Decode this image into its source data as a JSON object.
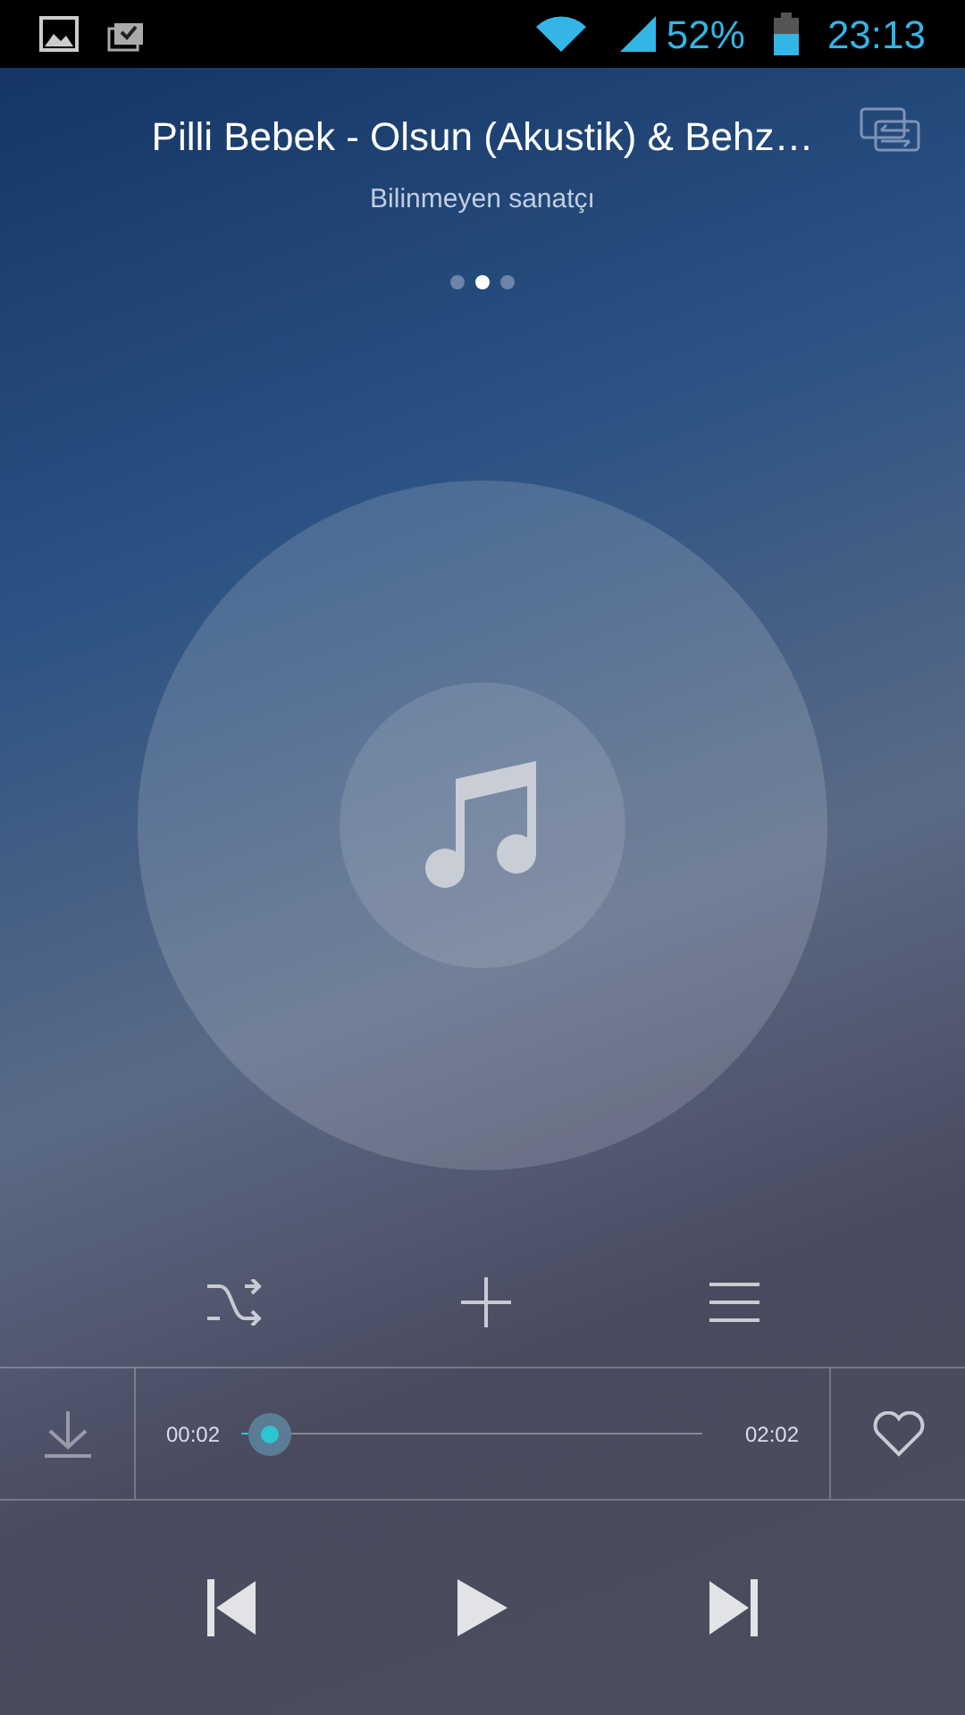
{
  "status_bar": {
    "battery": "52%",
    "time": "23:13"
  },
  "track": {
    "title": "Pilli Bebek - Olsun (Akustik) & Behz…",
    "artist": "Bilinmeyen sanatçı"
  },
  "pages": [
    {
      "selected": false
    },
    {
      "selected": true
    },
    {
      "selected": false
    }
  ],
  "progress": {
    "elapsed": "00:02",
    "total": "02:02",
    "level": 0.016
  }
}
